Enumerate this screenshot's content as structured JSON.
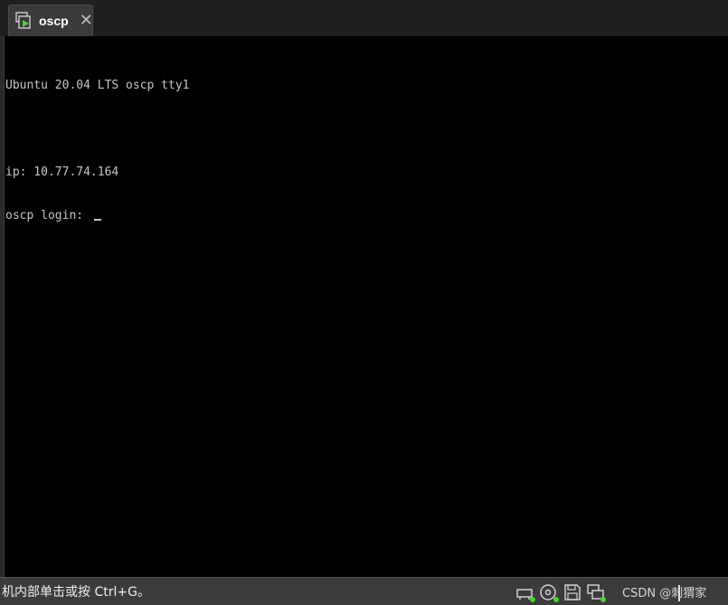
{
  "tab": {
    "title": "oscp",
    "icon": "vm-running-icon",
    "close_icon": "close-icon"
  },
  "console": {
    "lines": [
      "Ubuntu 20.04 LTS oscp tty1",
      "",
      "ip: 10.77.74.164",
      "oscp login: "
    ]
  },
  "statusbar": {
    "hint": "机内部单击或按 Ctrl+G。",
    "icons": [
      "network-adapter-icon",
      "cd-drive-icon",
      "floppy-drive-icon",
      "display-icon"
    ],
    "watermark": "CSDN @刺猬家"
  },
  "colors": {
    "console_bg": "#000000",
    "console_fg": "#c6c6c6",
    "accent_green": "#4cd137"
  }
}
